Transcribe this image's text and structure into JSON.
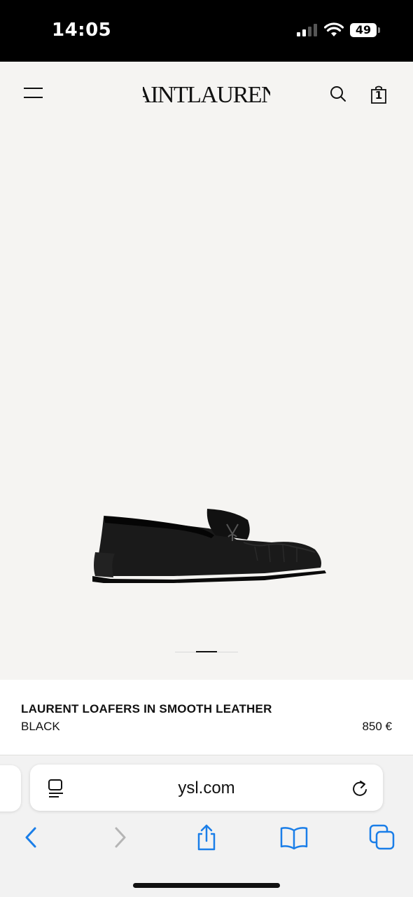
{
  "status_bar": {
    "time": "14:05",
    "battery": "49",
    "icons": [
      "signal-icon",
      "wifi-icon",
      "battery-icon"
    ]
  },
  "header": {
    "logo_text": "SAINT LAURENT",
    "icons": [
      "menu-icon",
      "search-icon",
      "bag-icon"
    ],
    "cart_count": "1"
  },
  "gallery": {
    "slides_total": 3,
    "active_slide": 2,
    "image_subject": "shoe"
  },
  "product": {
    "name": "LAURENT LOAFERS IN SMOOTH LEATHER",
    "color": "BLACK",
    "price": "850 €"
  },
  "browser": {
    "url": "ysl.com",
    "icons": [
      "reader-icon",
      "reload-icon",
      "back-icon",
      "forward-icon",
      "share-icon",
      "bookmarks-icon",
      "tabs-icon"
    ],
    "accent": "#1a7ee8"
  }
}
